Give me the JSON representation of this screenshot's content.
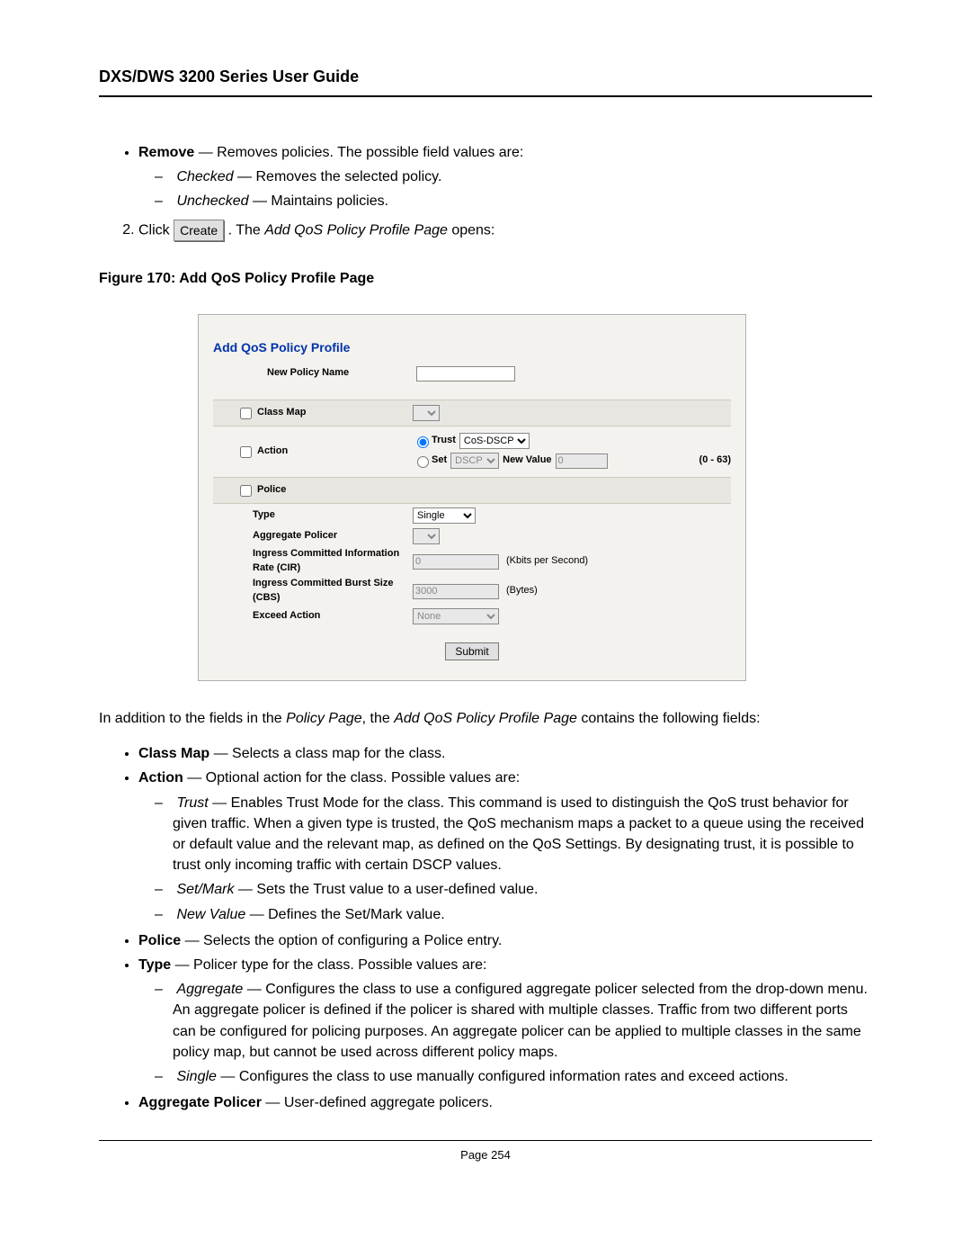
{
  "doc_title": "DXS/DWS 3200 Series User Guide",
  "page_number_label": "Page 254",
  "intro": {
    "remove_lbl": "Remove",
    "remove_desc": " — Removes policies. The possible field values are:",
    "checked_lbl": "Checked",
    "checked_desc": " — Removes the selected policy.",
    "unchecked_lbl": "Unchecked",
    "unchecked_desc": " — Maintains policies."
  },
  "step2": {
    "prefix": "Click  ",
    "btn_label": "Create",
    "suffix_1": ". The ",
    "suffix_em": "Add QoS Policy Profile Page",
    "suffix_2": " opens:"
  },
  "fig_caption": "Figure 170: Add QoS Policy Profile Page",
  "figure": {
    "title": "Add QoS Policy Profile",
    "new_policy_name_lbl": "New Policy Name",
    "new_policy_name_val": "",
    "class_map_lbl": "Class Map",
    "class_map_val": "",
    "action_lbl": "Action",
    "trust_lbl": "Trust",
    "trust_sel": "CoS-DSCP",
    "set_lbl": "Set",
    "set_sel": "DSCP",
    "new_value_lbl": "New Value",
    "new_value_val": "0",
    "new_value_range": "(0 - 63)",
    "police_lbl": "Police",
    "type_lbl": "Type",
    "type_sel": "Single",
    "agg_policer_lbl": "Aggregate Policer",
    "agg_policer_val": "",
    "cir_lbl": "Ingress Committed Information Rate (CIR)",
    "cir_val": "0",
    "cir_unit": "(Kbits per Second)",
    "cbs_lbl": "Ingress Committed Burst Size (CBS)",
    "cbs_val": "3000",
    "cbs_unit": "(Bytes)",
    "exceed_lbl": "Exceed Action",
    "exceed_sel": "None",
    "submit_btn": "Submit"
  },
  "post": {
    "intro_1": "In addition to the fields in the ",
    "intro_em1": "Policy Page",
    "intro_2": ", the ",
    "intro_em2": "Add QoS Policy Profile Page",
    "intro_3": " contains the following fields:",
    "class_map_lbl": "Class Map",
    "class_map_desc": " — Selects a class map for the class.",
    "action_lbl": "Action",
    "action_desc": " — Optional action for the class. Possible values are:",
    "trust_lbl": "Trust",
    "trust_desc": " — Enables Trust Mode for the class. This command is used to distinguish the QoS trust behavior for given traffic. When a given type is trusted, the QoS mechanism maps a packet to a queue using the received or default value and the relevant map, as defined on the QoS Settings. By designating trust, it is possible to trust only incoming traffic with certain DSCP values.",
    "setmark_lbl": "Set/Mark",
    "setmark_desc": " — Sets the Trust value to a user-defined value.",
    "newvalue_lbl": "New Value",
    "newvalue_desc": " — Defines the Set/Mark value.",
    "police_lbl": "Police",
    "police_desc": " — Selects the option of configuring a Police entry.",
    "type_lbl": "Type",
    "type_desc": " — Policer type for the class. Possible values are:",
    "aggregate_lbl": "Aggregate",
    "aggregate_desc": " — Configures the class to use a configured aggregate policer selected from the drop-down menu. An aggregate policer is defined if the policer is shared with multiple classes. Traffic from two different ports can be configured for policing purposes. An aggregate policer can be applied to multiple classes in the same policy map, but cannot be used across different policy maps.",
    "single_lbl": "Single",
    "single_desc": " — Configures the class to use manually configured information rates and exceed actions.",
    "agg_policer_lbl": "Aggregate Policer",
    "agg_policer_desc": " — User-defined aggregate policers."
  }
}
